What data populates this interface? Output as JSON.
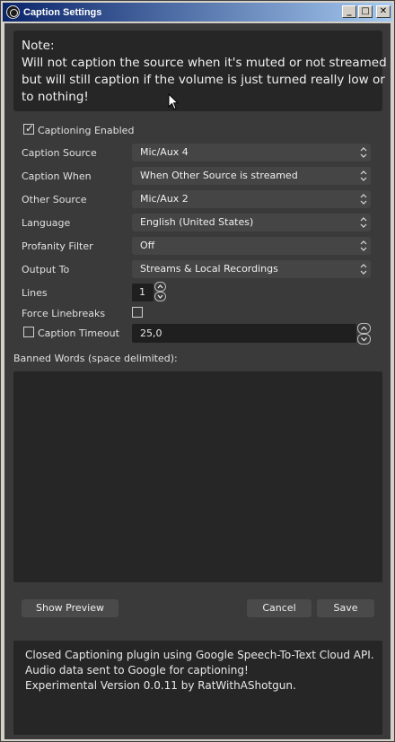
{
  "window": {
    "title": "Caption Settings",
    "buttons": {
      "minimize": "_",
      "maximize": "□",
      "close": "✕"
    }
  },
  "note": {
    "lines": [
      "Note:",
      "Will not caption the source when it's muted or not streamed",
      "but will still caption if the volume is just turned really low or",
      "to nothing!"
    ]
  },
  "captioning_enabled": {
    "label": "Captioning Enabled",
    "checked": true
  },
  "fields": [
    {
      "label": "Caption Source",
      "value": "Mic/Aux 4"
    },
    {
      "label": "Caption When",
      "value": "When Other Source is streamed"
    },
    {
      "label": "Other Source",
      "value": "Mic/Aux 2"
    },
    {
      "label": "Language",
      "value": "English (United States)"
    },
    {
      "label": "Profanity Filter",
      "value": "Off"
    },
    {
      "label": "Output To",
      "value": "Streams & Local Recordings"
    }
  ],
  "lines": {
    "label": "Lines",
    "value": "1"
  },
  "force_linebreaks": {
    "label": "Force Linebreaks",
    "checked": false
  },
  "caption_timeout": {
    "label": "Caption Timeout",
    "checked": false,
    "value": "25,0"
  },
  "banned_words": {
    "label": "Banned Words (space delimited):",
    "value": ""
  },
  "buttons": {
    "show_preview": "Show Preview",
    "cancel": "Cancel",
    "save": "Save"
  },
  "footer": {
    "lines": [
      "Closed Captioning plugin using Google Speech-To-Text Cloud API.",
      "Audio data sent to Google for captioning!",
      "",
      "Experimental Version 0.0.11 by RatWithAShotgun."
    ]
  },
  "colors": {
    "background": "#3a3a3a",
    "panel": "#262626",
    "combo": "#454545",
    "text": "#e8e8e8"
  }
}
